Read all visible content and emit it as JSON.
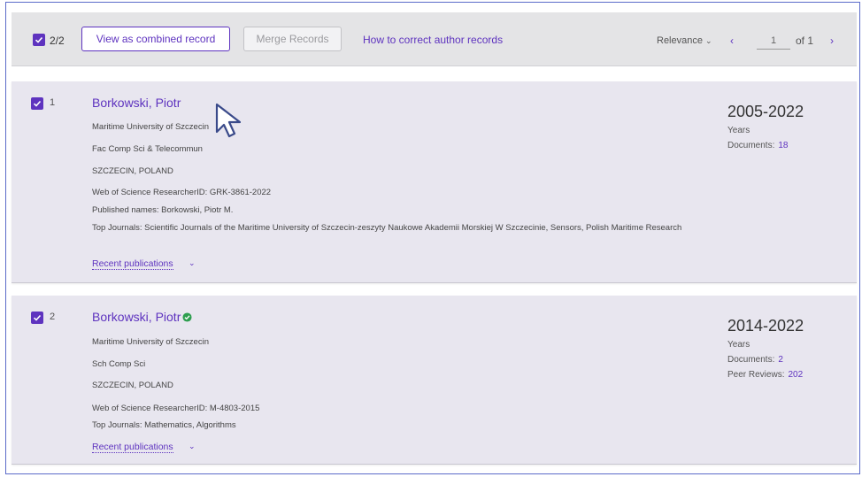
{
  "toolbar": {
    "selected_count": "2/2",
    "view_combined_label": "View as combined record",
    "merge_label": "Merge Records",
    "help_link": "How to correct author records",
    "sort_label": "Relevance",
    "page_current": "1",
    "page_of": "of 1",
    "prev_icon": "‹",
    "next_icon": "›"
  },
  "records": [
    {
      "index": "1",
      "name": "Borkowski, Piotr",
      "verified": false,
      "institution": "Maritime University of Szczecin",
      "department": "Fac Comp Sci & Telecommun",
      "location": "SZCZECIN, POLAND",
      "researcher_id": "Web of Science ResearcherID: GRK-3861-2022",
      "published_names": "Published names: Borkowski, Piotr M.",
      "top_journals": "Top Journals: Scientific Journals of the Maritime University of Szczecin-zeszyty Naukowe Akademii Morskiej W Szczecinie, Sensors, Polish Maritime Research",
      "recent_label": "Recent publications",
      "years": "2005-2022",
      "years_label": "Years",
      "documents_label": "Documents:",
      "documents_count": "18"
    },
    {
      "index": "2",
      "name": "Borkowski, Piotr",
      "verified": true,
      "institution": "Maritime University of Szczecin",
      "department": "Sch Comp Sci",
      "location": "SZCZECIN, POLAND",
      "researcher_id": "Web of Science ResearcherID: M-4803-2015",
      "top_journals": "Top Journals: Mathematics, Algorithms",
      "recent_label": "Recent publications",
      "years": "2014-2022",
      "years_label": "Years",
      "documents_label": "Documents:",
      "documents_count": "2",
      "peer_reviews_label": "Peer Reviews:",
      "peer_reviews_count": "202"
    }
  ],
  "colors": {
    "accent": "#5e33bf",
    "card_bg": "#e8e6ef",
    "toolbar_bg": "#e4e4e6",
    "verified": "#2e9e4f"
  }
}
